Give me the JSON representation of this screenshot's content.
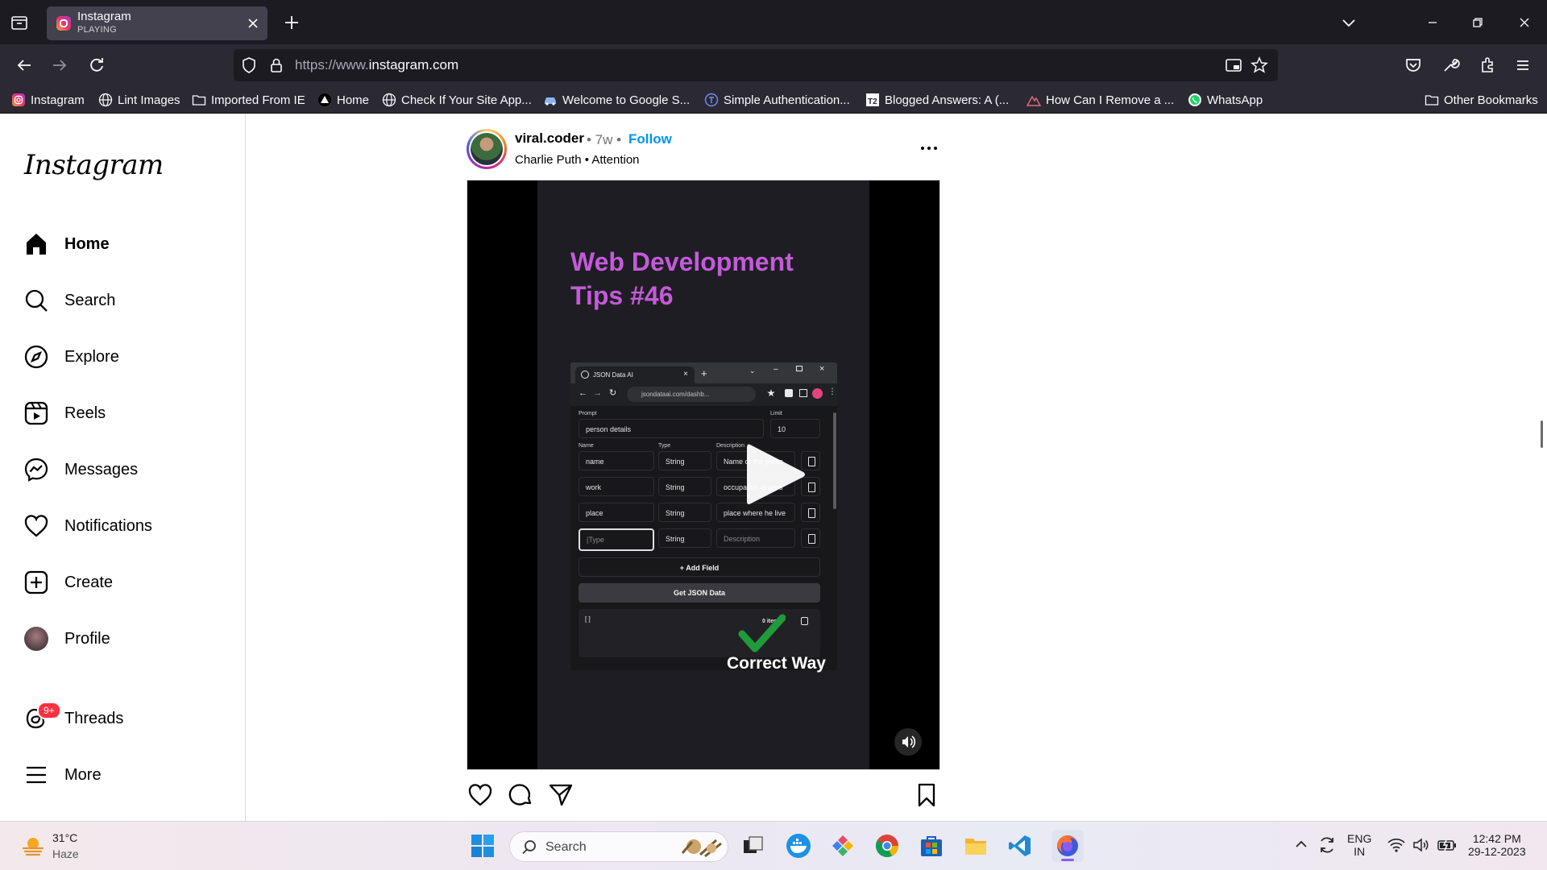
{
  "browser": {
    "tab": {
      "title": "Instagram",
      "status": "PLAYING"
    },
    "url": {
      "scheme": "https://www.",
      "host": "instagram.com"
    },
    "bookmarks": [
      {
        "label": "Instagram",
        "icon": "instagram-icon"
      },
      {
        "label": "Lint Images",
        "icon": "globe-icon"
      },
      {
        "label": "Imported From IE",
        "icon": "folder-icon"
      },
      {
        "label": "Home",
        "icon": "triangle-logo-icon"
      },
      {
        "label": "Check If Your Site App...",
        "icon": "globe-icon"
      },
      {
        "label": "Welcome to Google S...",
        "icon": "car-icon"
      },
      {
        "label": "Simple Authentication...",
        "icon": "letter-t-icon"
      },
      {
        "label": "Blogged Answers: A (...",
        "icon": "ts-icon"
      },
      {
        "label": "How Can I Remove a ...",
        "icon": "mountain-icon"
      },
      {
        "label": "WhatsApp",
        "icon": "whatsapp-icon"
      }
    ],
    "other_bookmarks": "Other Bookmarks"
  },
  "sidebar": {
    "logo": "Instagram",
    "items": [
      {
        "label": "Home",
        "icon": "home-icon"
      },
      {
        "label": "Search",
        "icon": "search-icon"
      },
      {
        "label": "Explore",
        "icon": "compass-icon"
      },
      {
        "label": "Reels",
        "icon": "reels-icon"
      },
      {
        "label": "Messages",
        "icon": "messenger-icon"
      },
      {
        "label": "Notifications",
        "icon": "heart-icon"
      },
      {
        "label": "Create",
        "icon": "plus-square-icon"
      },
      {
        "label": "Profile",
        "icon": "avatar"
      }
    ],
    "threads": {
      "label": "Threads",
      "badge": "9+"
    },
    "more": "More"
  },
  "post": {
    "username": "viral.coder",
    "time": "• 7w •",
    "follow": "Follow",
    "artist": "Charlie Puth",
    "song": "Attention",
    "audio_sep": " • ",
    "video": {
      "title_line1": "Web Development",
      "title_line2": "Tips #46",
      "overlay_caption": "Correct Way",
      "mini_browser": {
        "tab_title": "JSON Data AI",
        "url": "jsondataai.com/dashb...",
        "prompt_label": "Prompt",
        "prompt_value": "person details",
        "limit_label": "Limit",
        "limit_value": "10",
        "col_name": "Name",
        "col_type": "Type",
        "col_desc": "Description",
        "rows": [
          {
            "name": "name",
            "type": "String",
            "desc": "Name of the perso"
          },
          {
            "name": "work",
            "type": "String",
            "desc": "occupation of pers"
          },
          {
            "name": "place",
            "type": "String",
            "desc": "place where he live"
          },
          {
            "name": "|Type",
            "type": "String",
            "desc": "Description"
          }
        ],
        "add_field": "+ Add Field",
        "get_json": "Get JSON Data",
        "output_text": "[ ]",
        "items_count": "0 items"
      }
    }
  },
  "taskbar": {
    "weather_temp": "31°C",
    "weather_desc": "Haze",
    "search_placeholder": "Search",
    "lang_top": "ENG",
    "lang_bottom": "IN",
    "time": "12:42 PM",
    "date": "29-12-2023"
  },
  "colors": {
    "browser_dark": "#1c1b22",
    "toolbar": "#2b2a33",
    "ig_blue": "#0095f6",
    "video_title": "#c35bd9",
    "badge_red": "#ff3040"
  }
}
